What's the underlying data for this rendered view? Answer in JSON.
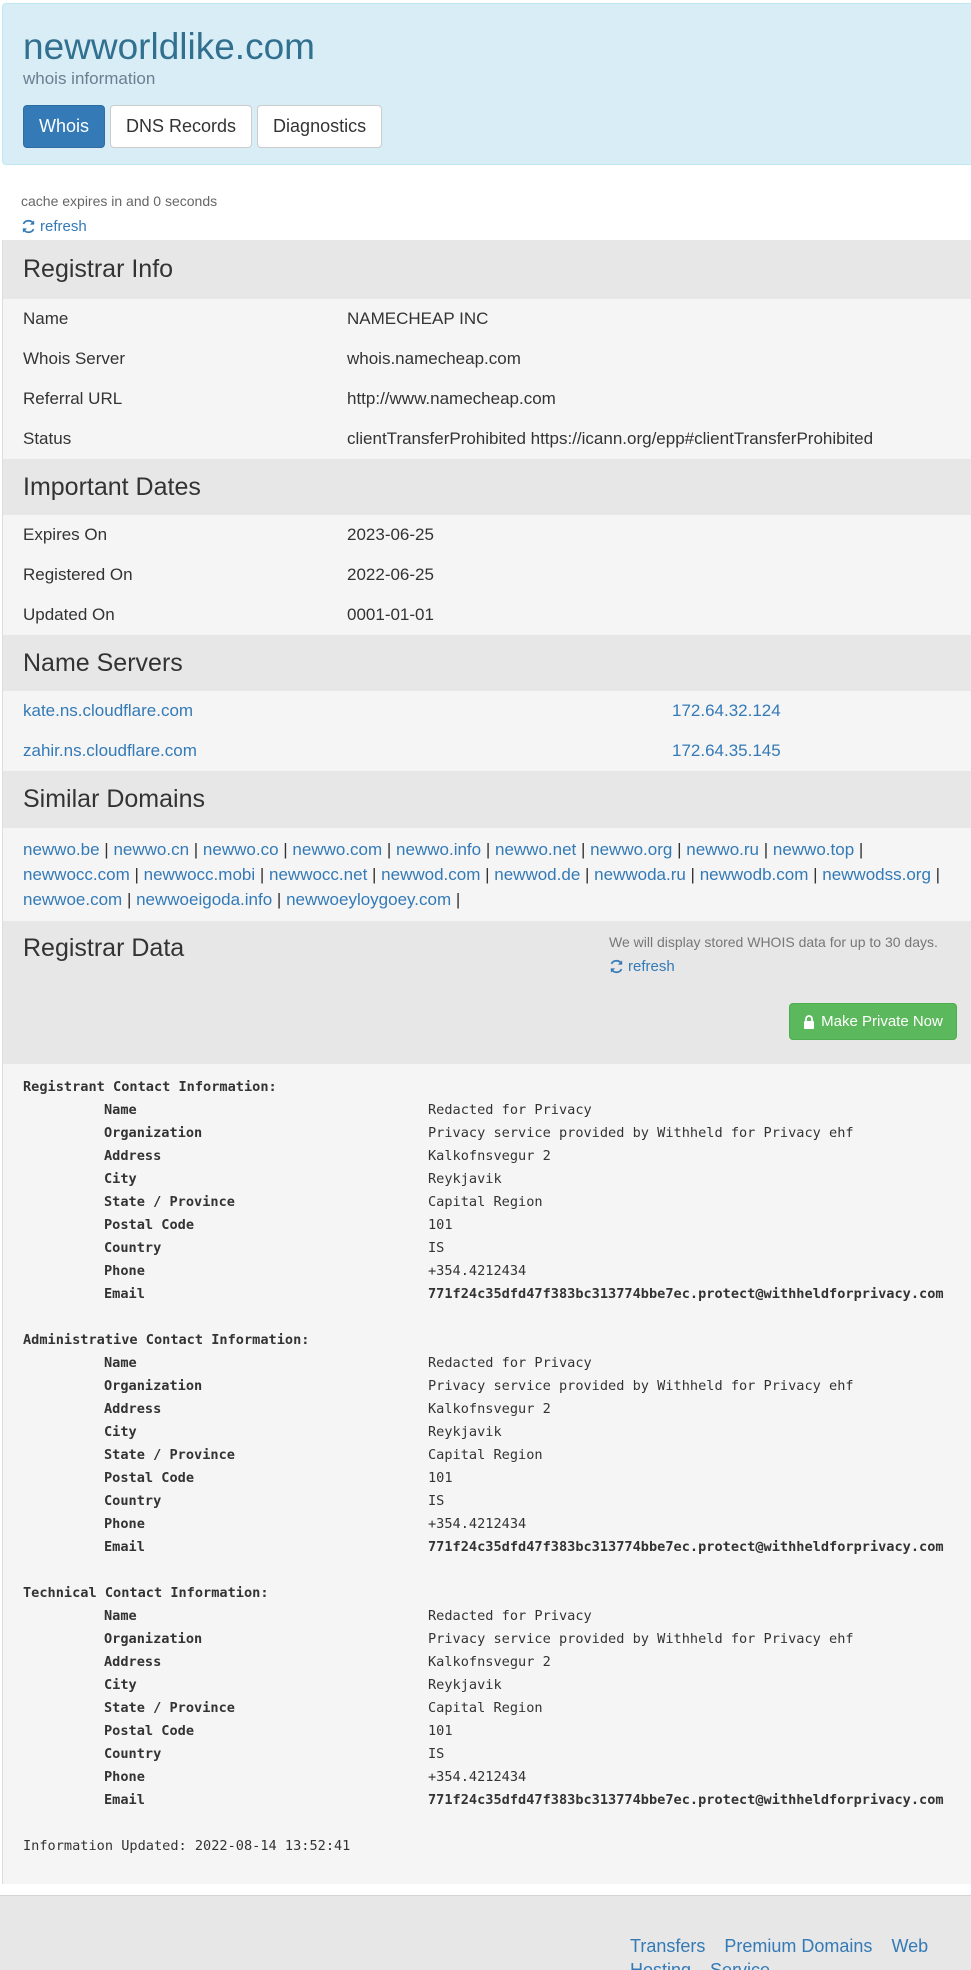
{
  "header": {
    "title": "newworldlike.com",
    "subtitle": "whois information",
    "tabs": [
      "Whois",
      "DNS Records",
      "Diagnostics"
    ]
  },
  "cache": {
    "text": "cache expires in and 0 seconds",
    "refresh": "refresh"
  },
  "registrar_info": {
    "heading": "Registrar Info",
    "rows": [
      {
        "k": "Name",
        "v": "NAMECHEAP INC"
      },
      {
        "k": "Whois Server",
        "v": "whois.namecheap.com"
      },
      {
        "k": "Referral URL",
        "v": "http://www.namecheap.com"
      },
      {
        "k": "Status",
        "v": "clientTransferProhibited https://icann.org/epp#clientTransferProhibited"
      }
    ]
  },
  "important_dates": {
    "heading": "Important Dates",
    "rows": [
      {
        "k": "Expires On",
        "v": "2023-06-25"
      },
      {
        "k": "Registered On",
        "v": "2022-06-25"
      },
      {
        "k": "Updated On",
        "v": "0001-01-01"
      }
    ]
  },
  "name_servers": {
    "heading": "Name Servers",
    "rows": [
      {
        "host": "kate.ns.cloudflare.com",
        "ip": "172.64.32.124"
      },
      {
        "host": "zahir.ns.cloudflare.com",
        "ip": "172.64.35.145"
      }
    ]
  },
  "similar_domains": {
    "heading": "Similar Domains",
    "domains": [
      "newwo.be",
      "newwo.cn",
      "newwo.co",
      "newwo.com",
      "newwo.info",
      "newwo.net",
      "newwo.org",
      "newwo.ru",
      "newwo.top",
      "newwocc.com",
      "newwocc.mobi",
      "newwocc.net",
      "newwod.com",
      "newwod.de",
      "newwoda.ru",
      "newwodb.com",
      "newwodss.org",
      "newwoe.com",
      "newwoeigoda.info",
      "newwoeyloygoey.com"
    ]
  },
  "registrar_data": {
    "heading": "Registrar Data",
    "note": "We will display stored WHOIS data for up to 30 days.",
    "refresh": "refresh",
    "make_private": "Make Private Now",
    "groups": [
      {
        "title": "Registrant Contact Information:",
        "fields": [
          {
            "k": "Name",
            "v": "Redacted for Privacy"
          },
          {
            "k": "Organization",
            "v": "Privacy service provided by Withheld for Privacy ehf"
          },
          {
            "k": "Address",
            "v": "Kalkofnsvegur 2"
          },
          {
            "k": "City",
            "v": "Reykjavik"
          },
          {
            "k": "State / Province",
            "v": "Capital Region"
          },
          {
            "k": "Postal Code",
            "v": "101"
          },
          {
            "k": "Country",
            "v": "IS"
          },
          {
            "k": "Phone",
            "v": "+354.4212434"
          },
          {
            "k": "Email",
            "v": "771f24c35dfd47f383bc313774bbe7ec.protect@withheldforprivacy.com"
          }
        ]
      },
      {
        "title": "Administrative Contact Information:",
        "fields": [
          {
            "k": "Name",
            "v": "Redacted for Privacy"
          },
          {
            "k": "Organization",
            "v": "Privacy service provided by Withheld for Privacy ehf"
          },
          {
            "k": "Address",
            "v": "Kalkofnsvegur 2"
          },
          {
            "k": "City",
            "v": "Reykjavik"
          },
          {
            "k": "State / Province",
            "v": "Capital Region"
          },
          {
            "k": "Postal Code",
            "v": "101"
          },
          {
            "k": "Country",
            "v": "IS"
          },
          {
            "k": "Phone",
            "v": "+354.4212434"
          },
          {
            "k": "Email",
            "v": "771f24c35dfd47f383bc313774bbe7ec.protect@withheldforprivacy.com"
          }
        ]
      },
      {
        "title": "Technical Contact Information:",
        "fields": [
          {
            "k": "Name",
            "v": "Redacted for Privacy"
          },
          {
            "k": "Organization",
            "v": "Privacy service provided by Withheld for Privacy ehf"
          },
          {
            "k": "Address",
            "v": "Kalkofnsvegur 2"
          },
          {
            "k": "City",
            "v": "Reykjavik"
          },
          {
            "k": "State / Province",
            "v": "Capital Region"
          },
          {
            "k": "Postal Code",
            "v": "101"
          },
          {
            "k": "Country",
            "v": "IS"
          },
          {
            "k": "Phone",
            "v": "+354.4212434"
          },
          {
            "k": "Email",
            "v": "771f24c35dfd47f383bc313774bbe7ec.protect@withheldforprivacy.com"
          }
        ]
      }
    ],
    "updated": "Information Updated: 2022-08-14 13:52:41"
  },
  "footer": {
    "links": [
      "Transfers",
      "Premium Domains",
      "Web Hosting",
      "Service"
    ]
  },
  "colors": {
    "link": "#337ab7",
    "header_bg": "#d9edf7",
    "primary": "#337ab7",
    "success": "#5cb85c"
  },
  "icons": {
    "refresh": "refresh-icon",
    "lock": "lock-icon"
  }
}
